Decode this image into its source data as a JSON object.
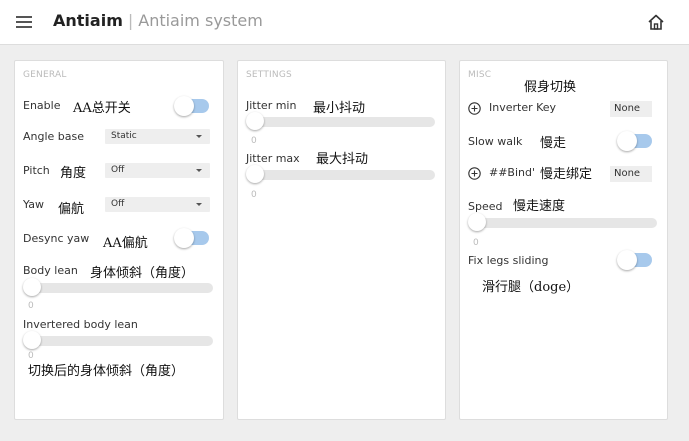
{
  "header": {
    "app_name": "Antiaim",
    "separator": "|",
    "subtitle": "Antiaim system",
    "menu_icon": "hamburger-icon",
    "home_icon": "home-icon"
  },
  "colors": {
    "toggle_track": "#a7c9ec",
    "panel_bg": "#ffffff",
    "page_bg": "#eeeeee"
  },
  "general": {
    "title": "GENERAL",
    "enable": {
      "label": "Enable",
      "note": "AA总开关",
      "on": false
    },
    "angle_base": {
      "label": "Angle base",
      "value": "Static"
    },
    "pitch": {
      "label": "Pitch",
      "note": "角度",
      "value": "Off"
    },
    "yaw": {
      "label": "Yaw",
      "note": "偏航",
      "value": "Off"
    },
    "desync_yaw": {
      "label": "Desync yaw",
      "note": "AA偏航",
      "on": false
    },
    "body_lean": {
      "label": "Body lean",
      "note": "身体倾斜（角度）",
      "value": "0"
    },
    "inverted_body_lean": {
      "label": "Invertered body lean",
      "note": "切换后的身体倾斜（角度）",
      "value": "0"
    }
  },
  "settings": {
    "title": "SETTINGS",
    "jitter_min": {
      "label": "Jitter min",
      "note": "最小抖动",
      "value": "0"
    },
    "jitter_max": {
      "label": "Jitter max",
      "note": "最大抖动",
      "value": "0"
    }
  },
  "misc": {
    "title": "MISC",
    "top_note": "假身切换",
    "inverter_key": {
      "label": "Inverter Key",
      "value": "None"
    },
    "slow_walk": {
      "label": "Slow walk",
      "note": "慢走",
      "on": false
    },
    "bind": {
      "label": "##Bind'",
      "note": "慢走绑定",
      "value": "None"
    },
    "speed": {
      "label": "Speed",
      "note": "慢走速度",
      "value": "0"
    },
    "fix_legs": {
      "label": "Fix legs sliding",
      "note": "滑行腿（doge）",
      "on": false
    }
  }
}
